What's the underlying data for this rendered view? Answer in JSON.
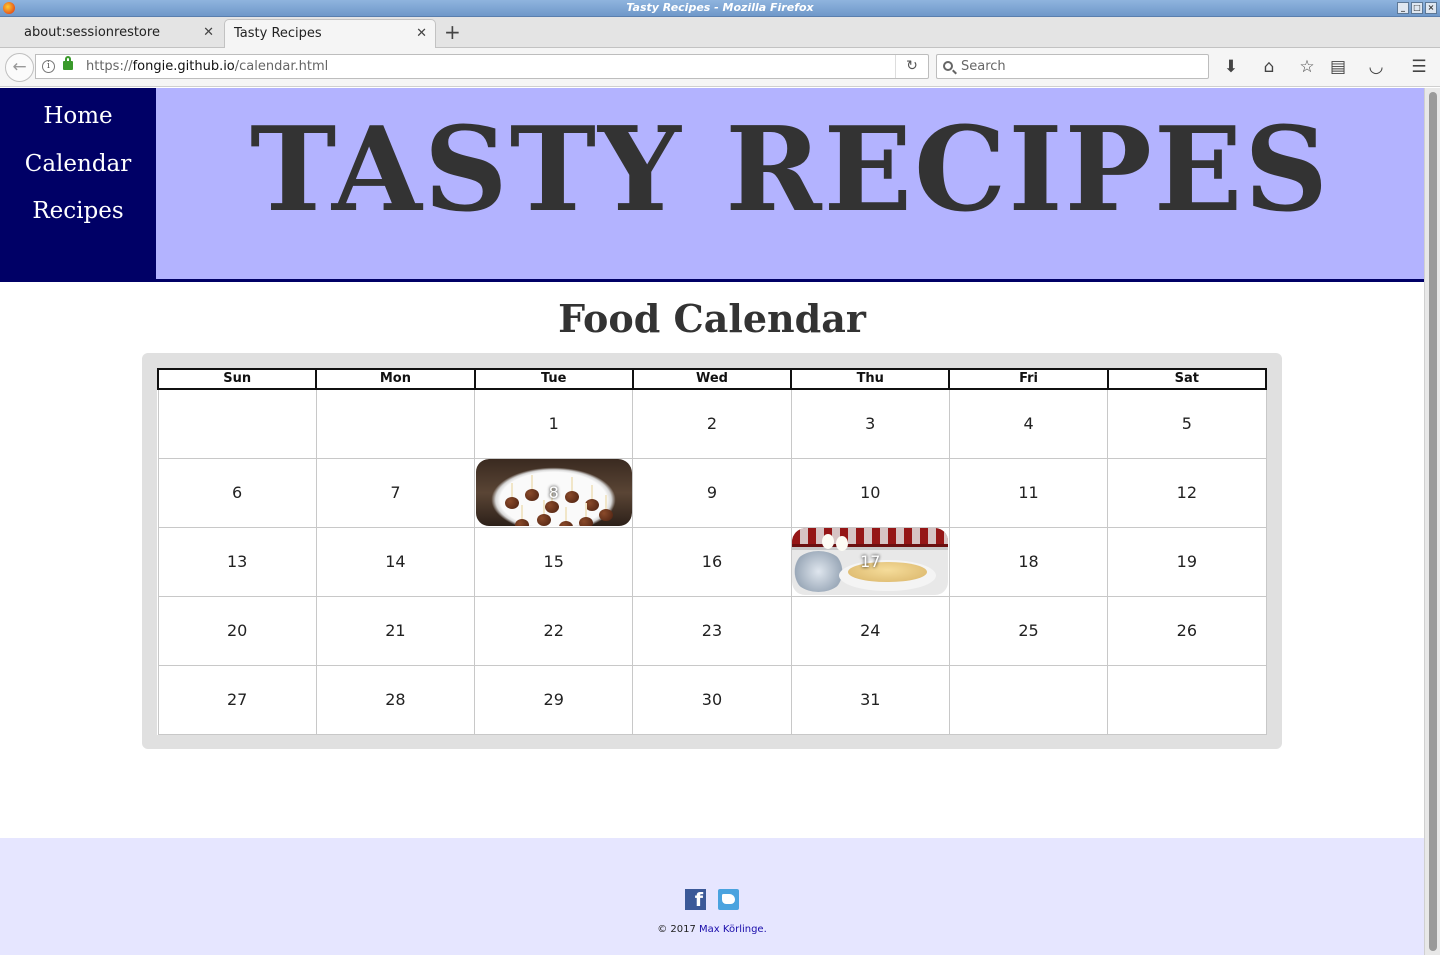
{
  "window": {
    "title": "Tasty Recipes - Mozilla Firefox"
  },
  "tabs": [
    {
      "label": "about:sessionrestore",
      "active": false
    },
    {
      "label": "Tasty Recipes",
      "active": true
    }
  ],
  "toolbar": {
    "url_prefix": "https://",
    "url_host": "fongie.github.io",
    "url_path": "/calendar.html",
    "search_placeholder": "Search"
  },
  "site": {
    "title": "TASTY RECIPES",
    "nav": [
      "Home",
      "Calendar",
      "Recipes"
    ],
    "colors": {
      "nav_bg": "#000066",
      "header_bg": "#b3b3ff",
      "footer_bg": "#e6e6ff"
    }
  },
  "calendar": {
    "title": "Food Calendar",
    "weekdays": [
      "Sun",
      "Mon",
      "Tue",
      "Wed",
      "Thu",
      "Fri",
      "Sat"
    ],
    "weeks": [
      [
        "",
        "",
        "1",
        "2",
        "3",
        "4",
        "5"
      ],
      [
        "6",
        "7",
        "8",
        "9",
        "10",
        "11",
        "12"
      ],
      [
        "13",
        "14",
        "15",
        "16",
        "17",
        "18",
        "19"
      ],
      [
        "20",
        "21",
        "22",
        "23",
        "24",
        "25",
        "26"
      ],
      [
        "27",
        "28",
        "29",
        "30",
        "31",
        "",
        ""
      ]
    ],
    "highlighted_days": [
      {
        "day": "8",
        "image": "meatballs"
      },
      {
        "day": "17",
        "image": "pancakes"
      }
    ]
  },
  "footer": {
    "social": [
      "facebook-icon",
      "twitter-icon"
    ],
    "copyright_prefix": "© 2017 ",
    "author": "Max Körlinge."
  }
}
